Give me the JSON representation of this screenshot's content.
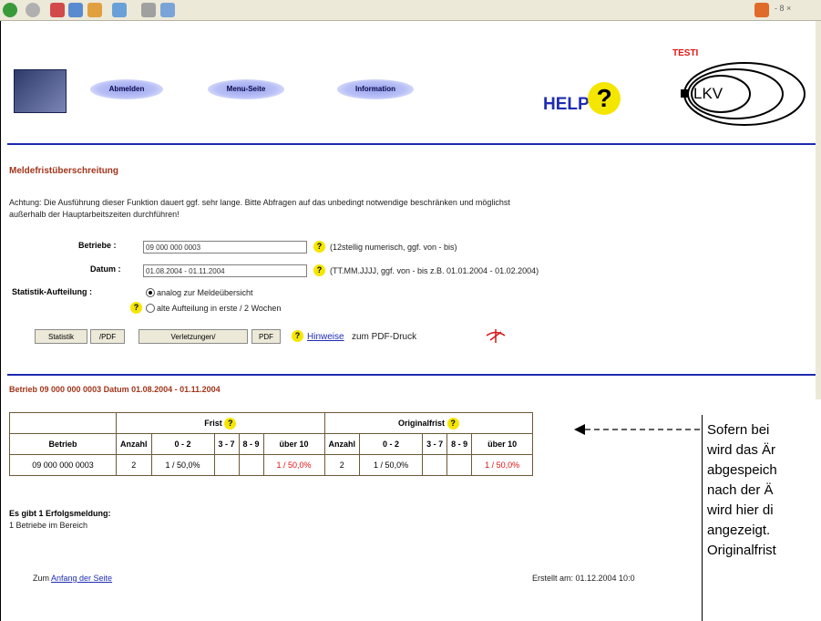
{
  "browser": {
    "toolbar_icons": [
      "back-icon",
      "forward-icon",
      "stop-icon",
      "refresh-icon",
      "home-icon",
      "search-icon",
      "print-icon",
      "edit-icon"
    ],
    "window_controls": "- 8 ×"
  },
  "header": {
    "testi": "TESTI",
    "nav": [
      "Abmelden",
      "Menu-Seite",
      "Information"
    ],
    "help_text": "HELP",
    "help_mark": "?",
    "logo_right": "LKV"
  },
  "main": {
    "title": "Meldefristüberschreitung",
    "warning_line1": "Achtung: Die Ausführung dieser Funktion dauert ggf. sehr lange. Bitte Abfragen auf das unbedingt notwendige beschränken und möglichst",
    "warning_line2": "außerhalb der Hauptarbeitszeiten durchführen!",
    "betriebe_label": "Betriebe :",
    "betriebe_value": "09 000 000 0003",
    "betriebe_hint": "(12stellig numerisch, ggf. von - bis)",
    "datum_label": "Datum :",
    "datum_value": "01.08.2004 - 01.11.2004",
    "datum_hint": "(TT.MM.JJJJ, ggf. von - bis z.B. 01.01.2004 - 01.02.2004)",
    "stat_label": "Statistik-Aufteilung :",
    "radio1": "analog zur Meldeübersicht",
    "radio2": "alte Aufteilung in erste / 2 Wochen",
    "btn_statistik": "Statistik",
    "btn_pdf1": "/PDF",
    "btn_verletzungen": "Verletzungen/",
    "btn_pdf2": "PDF",
    "hinweise_link": "Hinweise",
    "hinweise_rest": " zum PDF-Druck",
    "result_title": "Betrieb 09 000 000 0003 Datum 01.08.2004 - 01.11.2004",
    "table": {
      "group_headers": [
        "Frist",
        "Originalfrist"
      ],
      "columns": [
        "Betrieb",
        "Anzahl",
        "0 - 2",
        "3 - 7",
        "8 - 9",
        "über 10",
        "Anzahl",
        "0 - 2",
        "3 - 7",
        "8 - 9",
        "über 10"
      ],
      "row": [
        "09 000 000 0003",
        "2",
        "1 / 50,0%",
        "",
        "",
        "1 / 50,0%",
        "2",
        "1 / 50,0%",
        "",
        "",
        "1 / 50,0%"
      ]
    },
    "success_title": "Es gibt 1 Erfolgsmeldung:",
    "success_text": "1 Betriebe im Bereich",
    "footer_prefix": "Zum ",
    "footer_link": "Anfang der Seite",
    "created": "Erstellt am: 01.12.2004 10:0"
  },
  "annotation": {
    "lines": [
      "Sofern bei",
      "wird das Är",
      "abgespeich",
      "nach der Ä",
      "wird hier di",
      "angezeigt.",
      "Originalfrist"
    ]
  }
}
